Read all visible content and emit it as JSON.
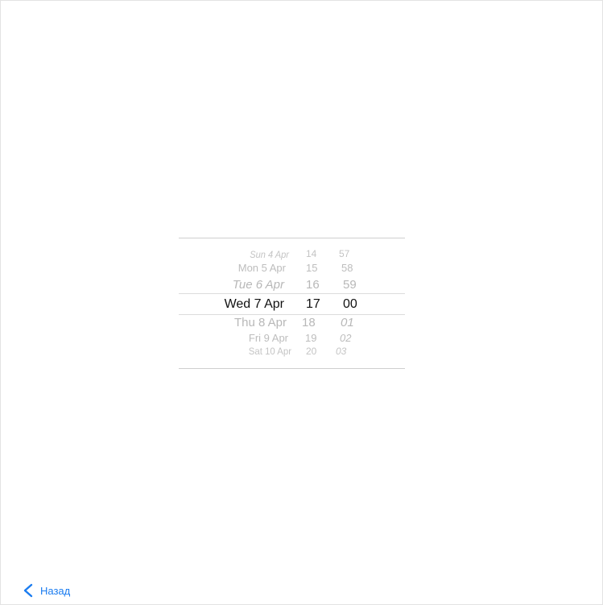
{
  "picker": {
    "days": [
      "Sun 4 Apr",
      "Mon 5 Apr",
      "Tue 6 Apr",
      "Wed 7 Apr",
      "Thu 8 Apr",
      "Fri 9 Apr",
      "Sat 10 Apr"
    ],
    "hours": [
      "14",
      "15",
      "16",
      "17",
      "18",
      "19",
      "20"
    ],
    "minutes": [
      "57",
      "58",
      "59",
      "00",
      "01",
      "02",
      "03"
    ],
    "selected_day": "Wed 7 Apr",
    "selected_hour": "17",
    "selected_minute": "00"
  },
  "footer": {
    "back_label": "Назад",
    "back_icon": "chevron-left-icon",
    "accent_color": "#1a7cf0"
  }
}
